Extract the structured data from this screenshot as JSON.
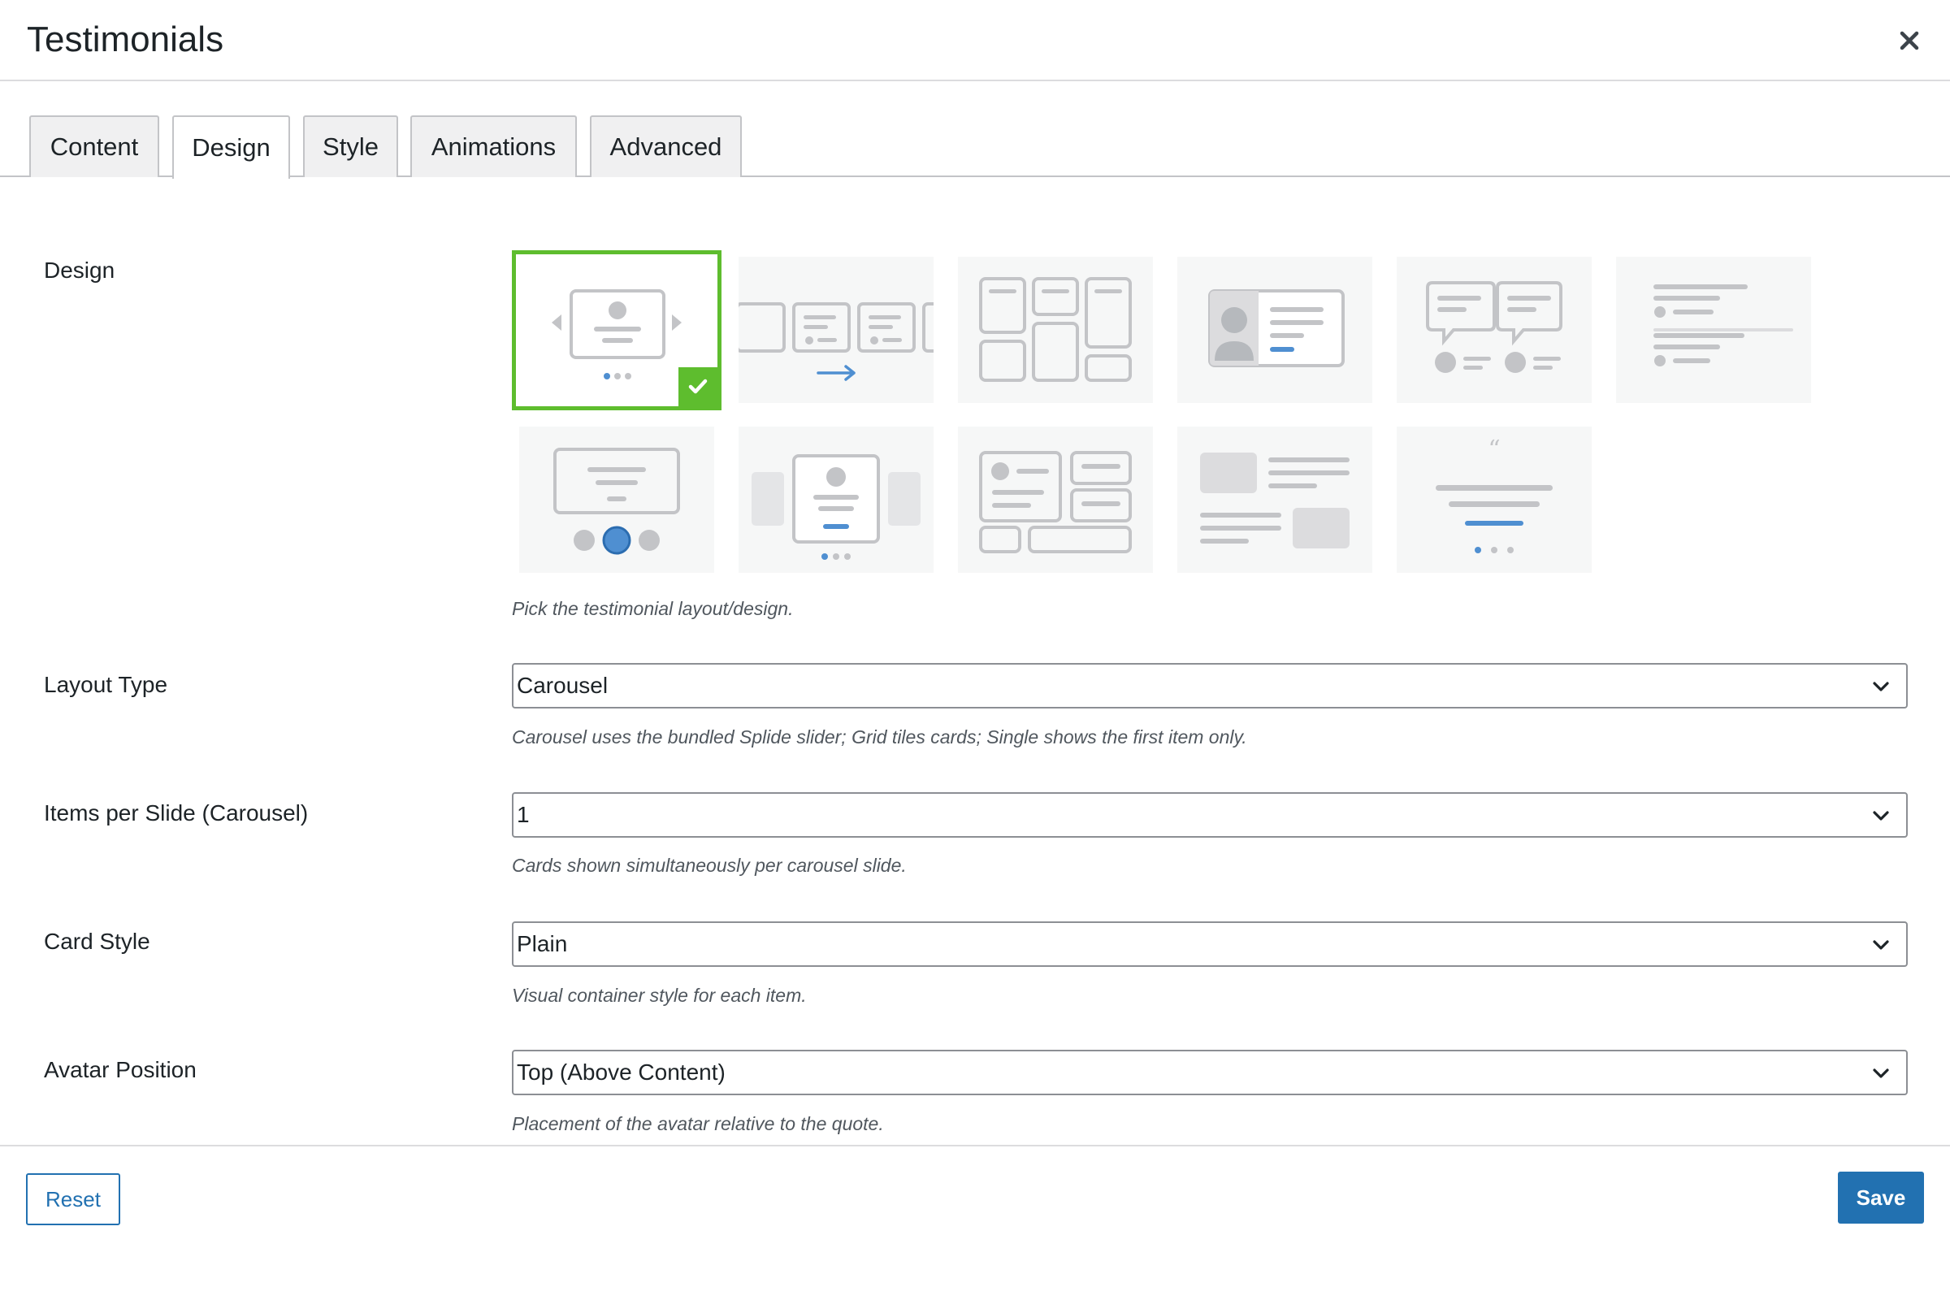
{
  "header": {
    "title": "Testimonials",
    "close_icon": "close-icon"
  },
  "tabs": [
    {
      "label": "Content",
      "active": false
    },
    {
      "label": "Design",
      "active": true
    },
    {
      "label": "Style",
      "active": false
    },
    {
      "label": "Animations",
      "active": false
    },
    {
      "label": "Advanced",
      "active": false
    }
  ],
  "design": {
    "label": "Design",
    "description": "Pick the testimonial layout/design.",
    "options": [
      {
        "icon": "carousel-arrows-layout-icon",
        "selected": true
      },
      {
        "icon": "sliding-cards-layout-icon",
        "selected": false
      },
      {
        "icon": "masonry-grid-layout-icon",
        "selected": false
      },
      {
        "icon": "profile-card-layout-icon",
        "selected": false
      },
      {
        "icon": "speech-bubbles-layout-icon",
        "selected": false
      },
      {
        "icon": "text-list-layout-icon",
        "selected": false
      },
      {
        "icon": "avatar-nav-carousel-layout-icon",
        "selected": false
      },
      {
        "icon": "centered-card-carousel-layout-icon",
        "selected": false
      },
      {
        "icon": "mixed-grid-layout-icon",
        "selected": false
      },
      {
        "icon": "alternating-media-layout-icon",
        "selected": false
      },
      {
        "icon": "quote-centered-layout-icon",
        "selected": false
      }
    ]
  },
  "layout_type": {
    "label": "Layout Type",
    "value": "Carousel",
    "description": "Carousel uses the bundled Splide slider; Grid tiles cards; Single shows the first item only."
  },
  "items_per_slide": {
    "label": "Items per Slide (Carousel)",
    "value": "1",
    "description": "Cards shown simultaneously per carousel slide."
  },
  "card_style": {
    "label": "Card Style",
    "value": "Plain",
    "description": "Visual container style for each item."
  },
  "avatar_position": {
    "label": "Avatar Position",
    "value": "Top (Above Content)",
    "description": "Placement of the avatar relative to the quote."
  },
  "footer": {
    "reset_label": "Reset",
    "save_label": "Save"
  },
  "colors": {
    "accent": "#2271b1",
    "selected": "#5ebd2e",
    "line": "#c3c4c7",
    "highlight": "#4f8fd1"
  }
}
